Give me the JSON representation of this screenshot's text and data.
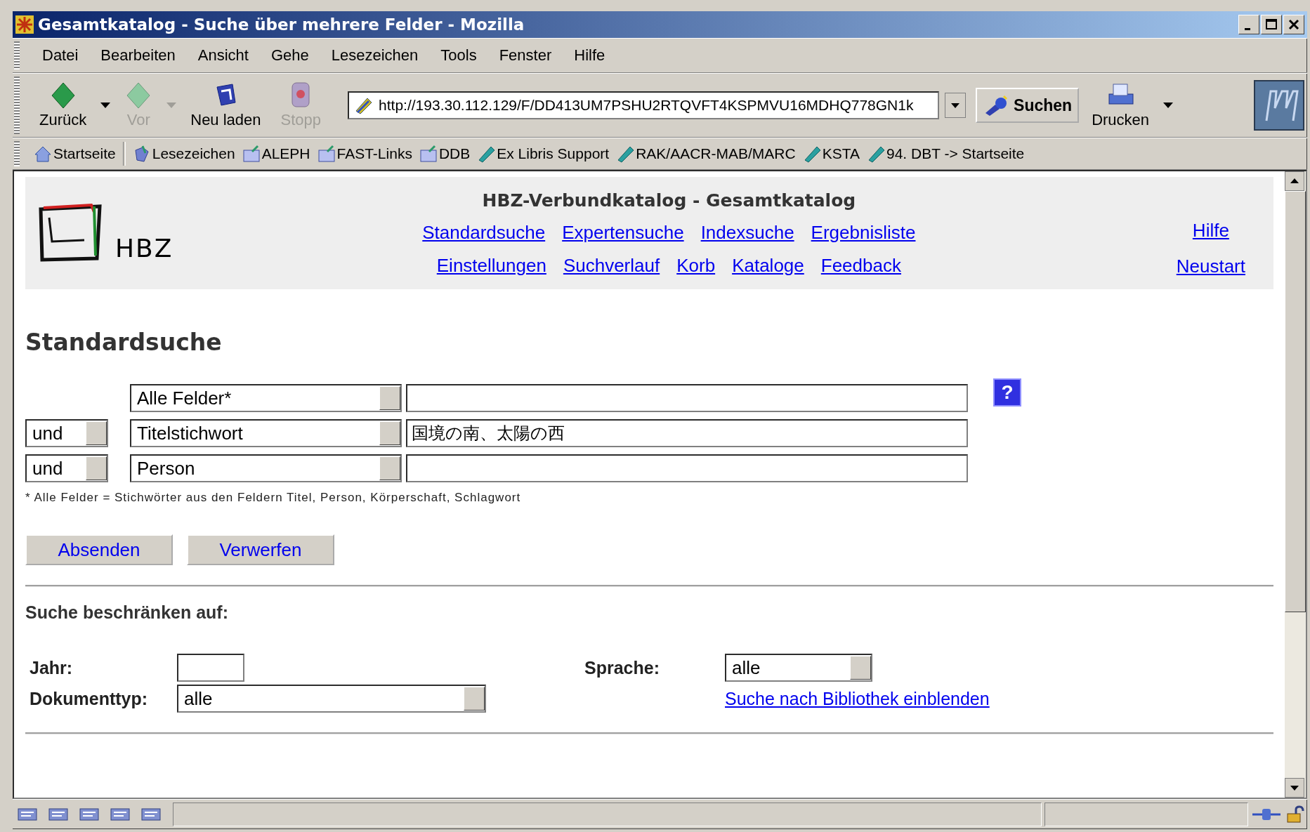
{
  "window": {
    "title": "Gesamtkatalog - Suche über mehrere Felder - Mozilla"
  },
  "menu": [
    "Datei",
    "Bearbeiten",
    "Ansicht",
    "Gehe",
    "Lesezeichen",
    "Tools",
    "Fenster",
    "Hilfe"
  ],
  "toolbar": {
    "buttons": [
      {
        "kind": "back",
        "label": "Zurück",
        "disabled": false,
        "dropdown": true
      },
      {
        "kind": "forward",
        "label": "Vor",
        "disabled": true,
        "dropdown": true
      },
      {
        "kind": "reload",
        "label": "Neu laden",
        "disabled": false,
        "dropdown": false
      },
      {
        "kind": "stop",
        "label": "Stopp",
        "disabled": true,
        "dropdown": false
      }
    ],
    "address": "http://193.30.112.129/F/DD413UM7PSHU2RTQVFT4KSPMVU16MDHQ778GN1k",
    "search_button": "Suchen",
    "print_button": "Drucken"
  },
  "bookmarks": [
    {
      "kind": "home",
      "label": "Startseite"
    },
    {
      "kind": "bookmarks",
      "label": "Lesezeichen"
    },
    {
      "kind": "folder",
      "label": "ALEPH"
    },
    {
      "kind": "folder",
      "label": "FAST-Links"
    },
    {
      "kind": "folder",
      "label": "DDB"
    },
    {
      "kind": "link",
      "label": "Ex Libris Support"
    },
    {
      "kind": "link",
      "label": "RAK/AACR-MAB/MARC"
    },
    {
      "kind": "link",
      "label": "KSTA"
    },
    {
      "kind": "link",
      "label": "94. DBT -> Startseite"
    }
  ],
  "header": {
    "logo_text": "HBZ",
    "title": "HBZ-Verbundkatalog - Gesamtkatalog",
    "nav_rows": [
      [
        "Standardsuche",
        "Expertensuche",
        "Indexsuche",
        "Ergebnisliste"
      ],
      [
        "Einstellungen",
        "Suchverlauf",
        "Korb",
        "Kataloge",
        "Feedback"
      ]
    ],
    "side_links": [
      "Hilfe",
      "Neustart"
    ]
  },
  "search": {
    "heading": "Standardsuche",
    "help_button": "?",
    "rows": [
      {
        "field": "Alle Felder*"
      },
      {
        "operator": "und",
        "field": "Titelstichwort",
        "value": "国境の南、太陽の西"
      },
      {
        "operator": "und",
        "field": "Person"
      }
    ],
    "note": "* Alle Felder = Stichwörter aus den Feldern Titel, Person, Körperschaft, Schlagwort",
    "buttons": [
      "Absenden",
      "Verwerfen"
    ]
  },
  "restrict": {
    "heading": "Suche beschränken auf:",
    "year_label": "Jahr:",
    "doctype_label": "Dokumenttyp:",
    "doctype_value": "alle",
    "language_label": "Sprache:",
    "language_value": "alle",
    "library_link": "Suche nach Bibliothek einblenden"
  }
}
